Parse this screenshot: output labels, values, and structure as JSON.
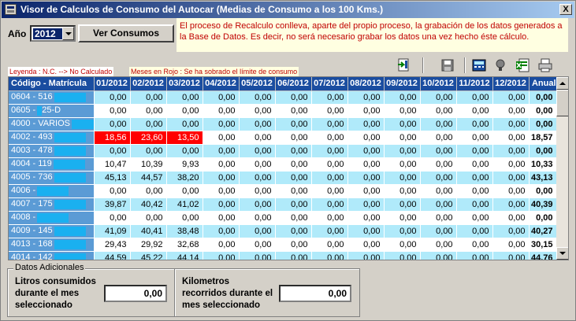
{
  "window": {
    "title": "Visor de Calculos de Consumo del Autocar (Medias de Consumo a los 100 Kms.)",
    "close_glyph": "X"
  },
  "controls": {
    "year_label": "Año",
    "year_value": "2012",
    "view_button": "Ver Consumos"
  },
  "notice": "El proceso de Recalculo conlleva, aparte del propio proceso, la grabación de los datos generados a la Base de Datos. Es decir, no será necesario grabar los datos una vez hecho éste cálculo.",
  "legend": {
    "nc": "Leyenda : N.C. --> No Calculado",
    "red": "Meses en Rojo : Se ha sobrado el límite de consumo"
  },
  "toolbar": {
    "icons": [
      "export-icon",
      "save-icon",
      "calculator-icon",
      "print-preview-icon",
      "excel-icon",
      "print-icon"
    ]
  },
  "table": {
    "headers": [
      "Código - Matrícula",
      "01/2012",
      "02/2012",
      "03/2012",
      "04/2012",
      "05/2012",
      "06/2012",
      "07/2012",
      "08/2012",
      "09/2012",
      "10/2012",
      "11/2012",
      "12/2012",
      "Anual"
    ],
    "rows": [
      {
        "code": "0604 - 516",
        "values": [
          "0,00",
          "0,00",
          "0,00",
          "0,00",
          "0,00",
          "0,00",
          "0,00",
          "0,00",
          "0,00",
          "0,00",
          "0,00",
          "0,00"
        ],
        "annual": "0,00",
        "red": []
      },
      {
        "code": "0605 -",
        "suffix": "25-D",
        "values": [
          "0,00",
          "0,00",
          "0,00",
          "0,00",
          "0,00",
          "0,00",
          "0,00",
          "0,00",
          "0,00",
          "0,00",
          "0,00",
          "0,00"
        ],
        "annual": "0,00",
        "red": []
      },
      {
        "code": "4000 - VARIOS",
        "values": [
          "0,00",
          "0,00",
          "0,00",
          "0,00",
          "0,00",
          "0,00",
          "0,00",
          "0,00",
          "0,00",
          "0,00",
          "0,00",
          "0,00"
        ],
        "annual": "0,00",
        "red": []
      },
      {
        "code": "4002 - 493",
        "values": [
          "18,56",
          "23,60",
          "13,50",
          "0,00",
          "0,00",
          "0,00",
          "0,00",
          "0,00",
          "0,00",
          "0,00",
          "0,00",
          "0,00"
        ],
        "annual": "18,57",
        "red": [
          0,
          1,
          2
        ]
      },
      {
        "code": "4003 - 478",
        "values": [
          "0,00",
          "0,00",
          "0,00",
          "0,00",
          "0,00",
          "0,00",
          "0,00",
          "0,00",
          "0,00",
          "0,00",
          "0,00",
          "0,00"
        ],
        "annual": "0,00",
        "red": []
      },
      {
        "code": "4004 - 119",
        "values": [
          "10,47",
          "10,39",
          "9,93",
          "0,00",
          "0,00",
          "0,00",
          "0,00",
          "0,00",
          "0,00",
          "0,00",
          "0,00",
          "0,00"
        ],
        "annual": "10,33",
        "red": []
      },
      {
        "code": "4005 - 736",
        "values": [
          "45,13",
          "44,57",
          "38,20",
          "0,00",
          "0,00",
          "0,00",
          "0,00",
          "0,00",
          "0,00",
          "0,00",
          "0,00",
          "0,00"
        ],
        "annual": "43,13",
        "red": []
      },
      {
        "code": "4006 -",
        "values": [
          "0,00",
          "0,00",
          "0,00",
          "0,00",
          "0,00",
          "0,00",
          "0,00",
          "0,00",
          "0,00",
          "0,00",
          "0,00",
          "0,00"
        ],
        "annual": "0,00",
        "red": []
      },
      {
        "code": "4007 - 175",
        "values": [
          "39,87",
          "40,42",
          "41,02",
          "0,00",
          "0,00",
          "0,00",
          "0,00",
          "0,00",
          "0,00",
          "0,00",
          "0,00",
          "0,00"
        ],
        "annual": "40,39",
        "red": []
      },
      {
        "code": "4008 -",
        "values": [
          "0,00",
          "0,00",
          "0,00",
          "0,00",
          "0,00",
          "0,00",
          "0,00",
          "0,00",
          "0,00",
          "0,00",
          "0,00",
          "0,00"
        ],
        "annual": "0,00",
        "red": []
      },
      {
        "code": "4009 - 145",
        "values": [
          "41,09",
          "40,41",
          "38,48",
          "0,00",
          "0,00",
          "0,00",
          "0,00",
          "0,00",
          "0,00",
          "0,00",
          "0,00",
          "0,00"
        ],
        "annual": "40,27",
        "red": []
      },
      {
        "code": "4013 - 168",
        "values": [
          "29,43",
          "29,92",
          "32,68",
          "0,00",
          "0,00",
          "0,00",
          "0,00",
          "0,00",
          "0,00",
          "0,00",
          "0,00",
          "0,00"
        ],
        "annual": "30,15",
        "red": []
      },
      {
        "code": "4014 - 142",
        "values": [
          "44,59",
          "45,22",
          "44,14",
          "0,00",
          "0,00",
          "0,00",
          "0,00",
          "0,00",
          "0,00",
          "0,00",
          "0,00",
          "0,00"
        ],
        "annual": "44,76",
        "red": []
      }
    ]
  },
  "extra": {
    "group_title": "Datos Adicionales",
    "liters_label": "Litros consumidos durante el mes seleccionado",
    "liters_value": "0,00",
    "km_label": "Kilometros recorridos durante el mes seleccionado",
    "km_value": "0,00"
  }
}
